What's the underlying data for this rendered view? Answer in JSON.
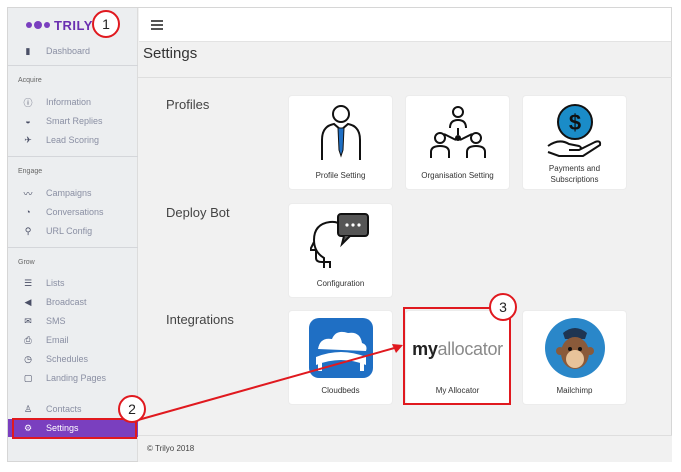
{
  "app": {
    "name": "TRILYO"
  },
  "sidebar": {
    "dashboard": "Dashboard",
    "acquire": {
      "heading": "Acquire",
      "items": [
        "Information",
        "Smart Replies",
        "Lead Scoring"
      ]
    },
    "engage": {
      "heading": "Engage",
      "items": [
        "Campaigns",
        "Conversations",
        "URL Config"
      ]
    },
    "grow": {
      "heading": "Grow",
      "items": [
        "Lists",
        "Broadcast",
        "SMS",
        "Email",
        "Schedules",
        "Landing Pages"
      ]
    },
    "bottom": [
      "Contacts",
      "Settings"
    ]
  },
  "page": {
    "title": "Settings"
  },
  "groups": {
    "profiles": {
      "label": "Profiles",
      "cards": [
        "Profile Setting",
        "Organisation Setting",
        "Payments and Subscriptions"
      ]
    },
    "deploy": {
      "label": "Deploy Bot",
      "cards": [
        "Configuration"
      ]
    },
    "integrations": {
      "label": "Integrations",
      "cards": [
        "Cloudbeds",
        "My Allocator",
        "Mailchimp"
      ]
    }
  },
  "myallocator_logo": {
    "my": "my",
    "rest": "allocator"
  },
  "footer": "© Trilyo 2018",
  "annotations": [
    "1",
    "2",
    "3"
  ],
  "colors": {
    "brand": "#7a3fbf",
    "annotation": "#e0191f",
    "cloudbeds": "#1f6fc4",
    "payments": "#1a8cc8"
  }
}
